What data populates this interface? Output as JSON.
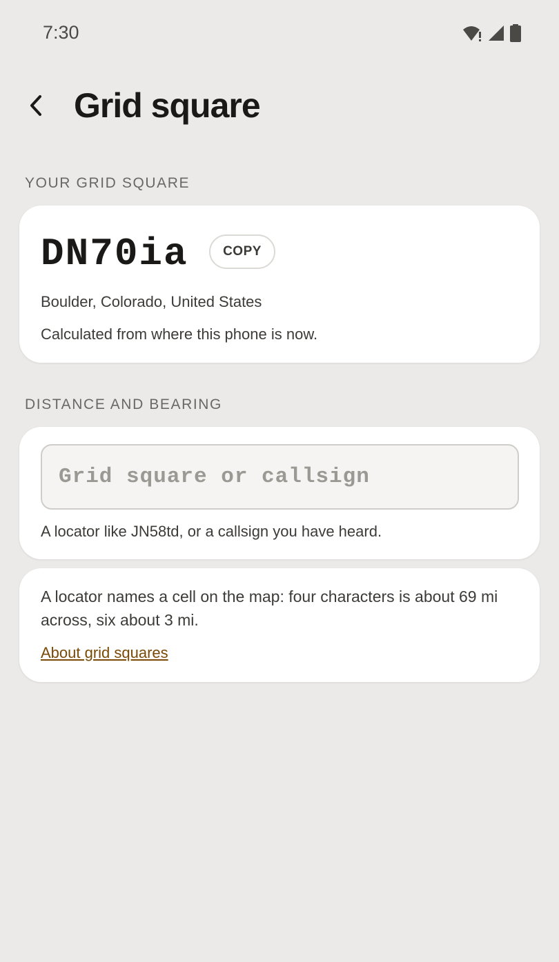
{
  "status_bar": {
    "time": "7:30",
    "icons": [
      "wifi-alert-icon",
      "cell-signal-icon",
      "battery-icon"
    ]
  },
  "header": {
    "back_icon": "chevron-left-icon",
    "title": "Grid square"
  },
  "your_grid": {
    "section_label": "YOUR GRID SQUARE",
    "code": "DN70ia",
    "copy_label": "COPY",
    "location": "Boulder, Colorado, United States",
    "note": "Calculated from where this phone is now."
  },
  "distance": {
    "section_label": "DISTANCE AND BEARING",
    "input_value": "",
    "input_placeholder": "Grid square or callsign",
    "helper": "A locator like JN58td, or a callsign you have heard."
  },
  "info": {
    "text": "A locator names a cell on the map: four characters is about 69 mi across, six about 3 mi.",
    "link_label": "About grid squares"
  },
  "colors": {
    "background": "#ebeae8",
    "card": "#ffffff",
    "link": "#7a4a05"
  }
}
